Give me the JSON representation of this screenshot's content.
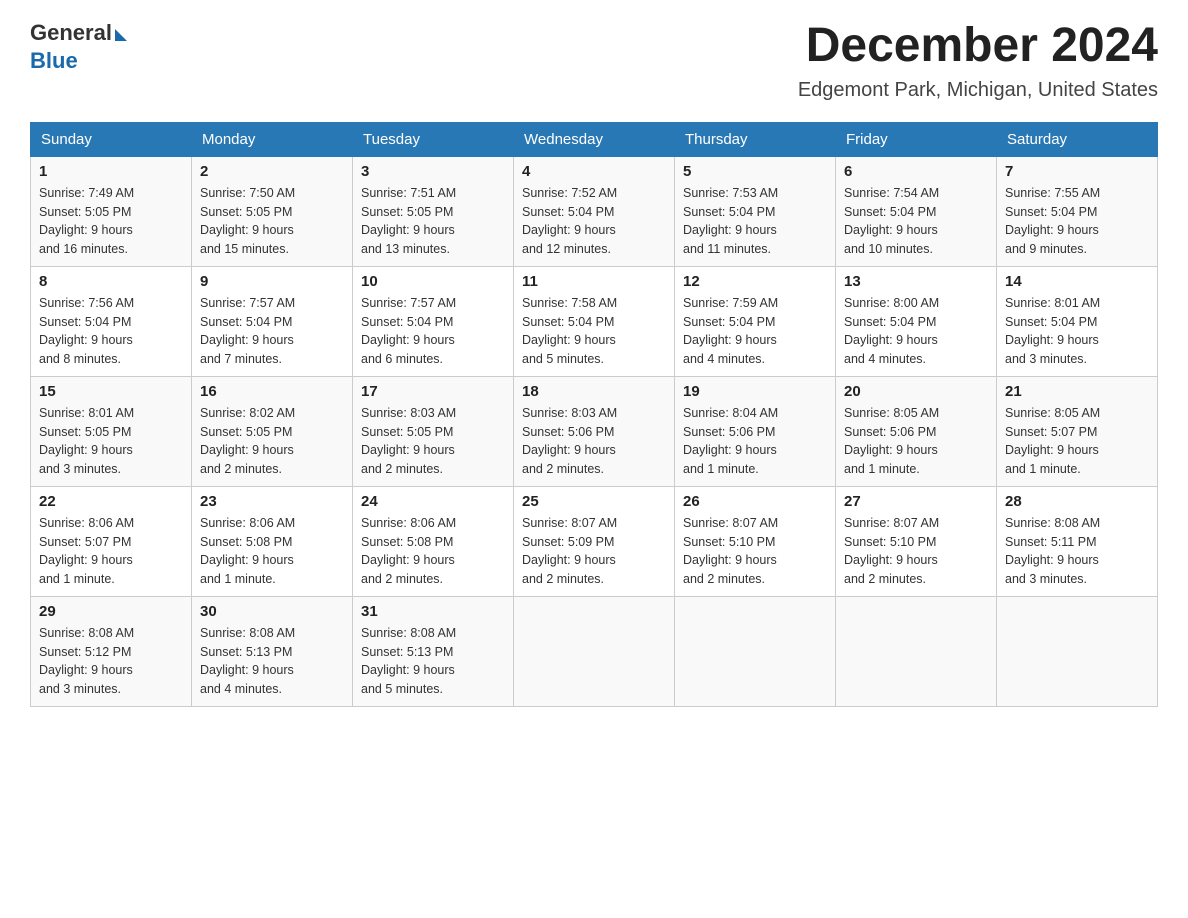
{
  "header": {
    "logo_general": "General",
    "logo_blue": "Blue",
    "month_title": "December 2024",
    "location": "Edgemont Park, Michigan, United States"
  },
  "days_of_week": [
    "Sunday",
    "Monday",
    "Tuesday",
    "Wednesday",
    "Thursday",
    "Friday",
    "Saturday"
  ],
  "weeks": [
    [
      {
        "day": "1",
        "sunrise": "7:49 AM",
        "sunset": "5:05 PM",
        "daylight": "9 hours and 16 minutes."
      },
      {
        "day": "2",
        "sunrise": "7:50 AM",
        "sunset": "5:05 PM",
        "daylight": "9 hours and 15 minutes."
      },
      {
        "day": "3",
        "sunrise": "7:51 AM",
        "sunset": "5:05 PM",
        "daylight": "9 hours and 13 minutes."
      },
      {
        "day": "4",
        "sunrise": "7:52 AM",
        "sunset": "5:04 PM",
        "daylight": "9 hours and 12 minutes."
      },
      {
        "day": "5",
        "sunrise": "7:53 AM",
        "sunset": "5:04 PM",
        "daylight": "9 hours and 11 minutes."
      },
      {
        "day": "6",
        "sunrise": "7:54 AM",
        "sunset": "5:04 PM",
        "daylight": "9 hours and 10 minutes."
      },
      {
        "day": "7",
        "sunrise": "7:55 AM",
        "sunset": "5:04 PM",
        "daylight": "9 hours and 9 minutes."
      }
    ],
    [
      {
        "day": "8",
        "sunrise": "7:56 AM",
        "sunset": "5:04 PM",
        "daylight": "9 hours and 8 minutes."
      },
      {
        "day": "9",
        "sunrise": "7:57 AM",
        "sunset": "5:04 PM",
        "daylight": "9 hours and 7 minutes."
      },
      {
        "day": "10",
        "sunrise": "7:57 AM",
        "sunset": "5:04 PM",
        "daylight": "9 hours and 6 minutes."
      },
      {
        "day": "11",
        "sunrise": "7:58 AM",
        "sunset": "5:04 PM",
        "daylight": "9 hours and 5 minutes."
      },
      {
        "day": "12",
        "sunrise": "7:59 AM",
        "sunset": "5:04 PM",
        "daylight": "9 hours and 4 minutes."
      },
      {
        "day": "13",
        "sunrise": "8:00 AM",
        "sunset": "5:04 PM",
        "daylight": "9 hours and 4 minutes."
      },
      {
        "day": "14",
        "sunrise": "8:01 AM",
        "sunset": "5:04 PM",
        "daylight": "9 hours and 3 minutes."
      }
    ],
    [
      {
        "day": "15",
        "sunrise": "8:01 AM",
        "sunset": "5:05 PM",
        "daylight": "9 hours and 3 minutes."
      },
      {
        "day": "16",
        "sunrise": "8:02 AM",
        "sunset": "5:05 PM",
        "daylight": "9 hours and 2 minutes."
      },
      {
        "day": "17",
        "sunrise": "8:03 AM",
        "sunset": "5:05 PM",
        "daylight": "9 hours and 2 minutes."
      },
      {
        "day": "18",
        "sunrise": "8:03 AM",
        "sunset": "5:06 PM",
        "daylight": "9 hours and 2 minutes."
      },
      {
        "day": "19",
        "sunrise": "8:04 AM",
        "sunset": "5:06 PM",
        "daylight": "9 hours and 1 minute."
      },
      {
        "day": "20",
        "sunrise": "8:05 AM",
        "sunset": "5:06 PM",
        "daylight": "9 hours and 1 minute."
      },
      {
        "day": "21",
        "sunrise": "8:05 AM",
        "sunset": "5:07 PM",
        "daylight": "9 hours and 1 minute."
      }
    ],
    [
      {
        "day": "22",
        "sunrise": "8:06 AM",
        "sunset": "5:07 PM",
        "daylight": "9 hours and 1 minute."
      },
      {
        "day": "23",
        "sunrise": "8:06 AM",
        "sunset": "5:08 PM",
        "daylight": "9 hours and 1 minute."
      },
      {
        "day": "24",
        "sunrise": "8:06 AM",
        "sunset": "5:08 PM",
        "daylight": "9 hours and 2 minutes."
      },
      {
        "day": "25",
        "sunrise": "8:07 AM",
        "sunset": "5:09 PM",
        "daylight": "9 hours and 2 minutes."
      },
      {
        "day": "26",
        "sunrise": "8:07 AM",
        "sunset": "5:10 PM",
        "daylight": "9 hours and 2 minutes."
      },
      {
        "day": "27",
        "sunrise": "8:07 AM",
        "sunset": "5:10 PM",
        "daylight": "9 hours and 2 minutes."
      },
      {
        "day": "28",
        "sunrise": "8:08 AM",
        "sunset": "5:11 PM",
        "daylight": "9 hours and 3 minutes."
      }
    ],
    [
      {
        "day": "29",
        "sunrise": "8:08 AM",
        "sunset": "5:12 PM",
        "daylight": "9 hours and 3 minutes."
      },
      {
        "day": "30",
        "sunrise": "8:08 AM",
        "sunset": "5:13 PM",
        "daylight": "9 hours and 4 minutes."
      },
      {
        "day": "31",
        "sunrise": "8:08 AM",
        "sunset": "5:13 PM",
        "daylight": "9 hours and 5 minutes."
      },
      null,
      null,
      null,
      null
    ]
  ],
  "labels": {
    "sunrise": "Sunrise:",
    "sunset": "Sunset:",
    "daylight": "Daylight:"
  }
}
